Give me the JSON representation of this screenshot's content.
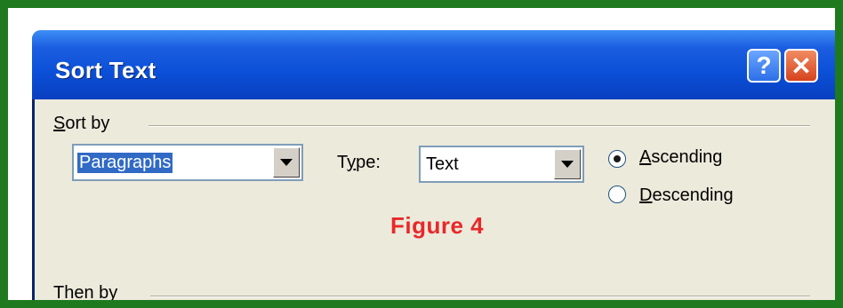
{
  "dialog": {
    "title": "Sort Text",
    "help_glyph": "?",
    "close_glyph": "✕"
  },
  "sort_by": {
    "group_label": "Sort by",
    "field_value": "Paragraphs",
    "type_label": "Type:",
    "type_value": "Text",
    "ascending_label": "Ascending",
    "descending_label": "Descending",
    "selected_order": "Ascending"
  },
  "then_by": {
    "group_label": "Then by"
  },
  "caption": {
    "text": "Figure 4",
    "color": "#e8282a"
  },
  "colors": {
    "frame": "#1f7a1f",
    "titlebar": "#0b50d8",
    "dialog_bg": "#eceadb",
    "selection": "#316ac5"
  },
  "icons": [
    "help-icon",
    "close-icon",
    "dropdown-arrow-icon"
  ]
}
